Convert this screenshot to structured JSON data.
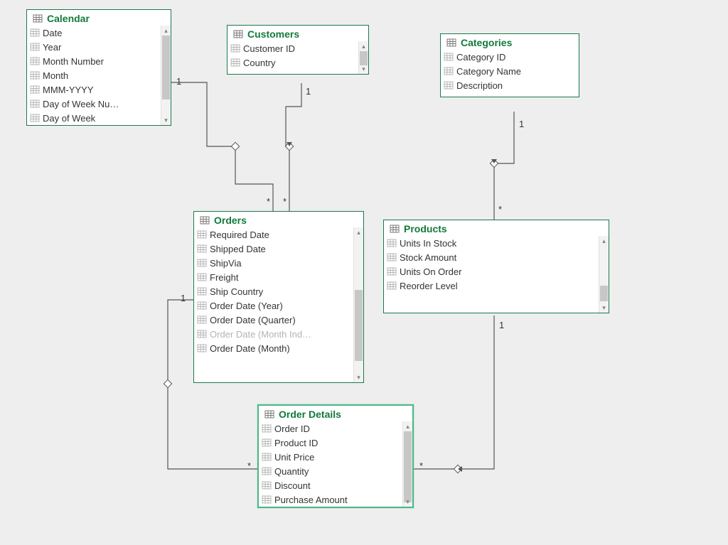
{
  "entities": {
    "calendar": {
      "title": "Calendar",
      "fields": [
        "Date",
        "Year",
        "Month Number",
        "Month",
        "MMM-YYYY",
        "Day of Week Nu…",
        "Day of Week"
      ]
    },
    "customers": {
      "title": "Customers",
      "fields": [
        "Customer ID",
        "Country"
      ]
    },
    "categories": {
      "title": "Categories",
      "fields": [
        "Category ID",
        "Category Name",
        "Description"
      ]
    },
    "orders": {
      "title": "Orders",
      "fields": [
        "Required Date",
        "Shipped Date",
        "ShipVia",
        "Freight",
        "Ship Country",
        "Order Date (Year)",
        "Order Date (Quarter)",
        "Order Date (Month Ind…",
        "Order Date (Month)"
      ]
    },
    "products": {
      "title": "Products",
      "fields": [
        "Units In Stock",
        "Stock Amount",
        "Units On Order",
        "Reorder Level"
      ]
    },
    "orderdetails": {
      "title": "Order Details",
      "fields": [
        "Order ID",
        "Product ID",
        "Unit Price",
        "Quantity",
        "Discount",
        "Purchase Amount"
      ]
    }
  },
  "cardinality": {
    "one": "1",
    "many": "*"
  },
  "relationships": [
    {
      "from": "calendar",
      "to": "orders",
      "from_card": "1",
      "to_card": "*"
    },
    {
      "from": "customers",
      "to": "orders",
      "from_card": "1",
      "to_card": "*"
    },
    {
      "from": "categories",
      "to": "products",
      "from_card": "1",
      "to_card": "*"
    },
    {
      "from": "orders",
      "to": "orderdetails",
      "from_card": "1",
      "to_card": "*"
    },
    {
      "from": "products",
      "to": "orderdetails",
      "from_card": "1",
      "to_card": "*"
    }
  ]
}
